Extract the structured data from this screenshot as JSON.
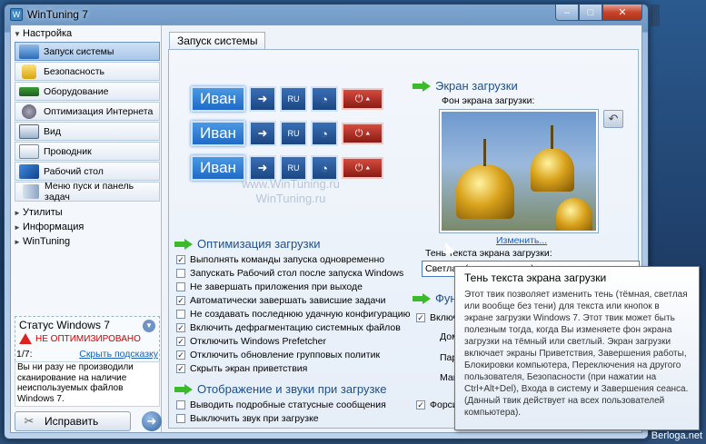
{
  "window": {
    "title": "WinTuning 7",
    "minimize": "–",
    "maximize": "□",
    "close": "✕"
  },
  "sidebar": {
    "header": "Настройка",
    "items": [
      {
        "label": "Запуск системы",
        "icon": "startup-icon"
      },
      {
        "label": "Безопасность",
        "icon": "lock-icon"
      },
      {
        "label": "Оборудование",
        "icon": "hardware-icon"
      },
      {
        "label": "Оптимизация Интернета",
        "icon": "internet-icon"
      },
      {
        "label": "Вид",
        "icon": "view-icon"
      },
      {
        "label": "Проводник",
        "icon": "explorer-icon"
      },
      {
        "label": "Рабочий стол",
        "icon": "desktop-icon"
      },
      {
        "label": "Меню пуск и панель задач",
        "icon": "taskbar-icon"
      }
    ],
    "sections": [
      "Утилиты",
      "Информация",
      "WinTuning"
    ]
  },
  "status": {
    "title": "Статус Windows 7",
    "state": "НЕ ОПТИМИЗИРОВАНО",
    "counter": "1/7:",
    "next_tip": "Скрыть подсказку",
    "tip": "Вы ни разу не производили сканирование на наличие неиспользуемых файлов Windows 7.",
    "fix_label": "Исправить"
  },
  "main": {
    "tab": "Запуск системы",
    "preview": {
      "name": "Иван",
      "ru": "RU",
      "watermark1": "www.WinTuning.ru",
      "watermark2": "WinTuning.ru"
    },
    "boot_opt": {
      "title": "Оптимизация загрузки",
      "options": [
        {
          "label": "Выполнять команды запуска одновременно",
          "checked": true
        },
        {
          "label": "Запускать Рабочий стол после запуска Windows",
          "checked": false
        },
        {
          "label": "Не завершать приложения при выходе",
          "checked": false
        },
        {
          "label": "Автоматически завершать зависшие задачи",
          "checked": true
        },
        {
          "label": "Не создавать последнюю удачную конфигурацию",
          "checked": false
        },
        {
          "label": "Включить дефрагментацию системных файлов",
          "checked": true
        },
        {
          "label": "Отключить Windows Prefetcher",
          "checked": true
        },
        {
          "label": "Отключить обновление групповых политик",
          "checked": true
        },
        {
          "label": "Скрыть экран приветствия",
          "checked": true
        }
      ]
    },
    "display": {
      "title": "Отображение и звуки при загрузке",
      "options": [
        {
          "label": "Выводить подробные статусные сообщения",
          "checked": false
        },
        {
          "label": "Выключить звук при загрузке",
          "checked": false
        }
      ]
    },
    "boot_screen": {
      "title": "Экран загрузки",
      "bg_label": "Фон экрана загрузки:",
      "change_link": "Изменить...",
      "shadow_label": "Тень текста экрана загрузки:",
      "shadow_value": "Светлая (по умолчанию) тень текста экрана загру"
    },
    "functions": {
      "title": "Функ",
      "enable": "Включит",
      "domain": "Доме",
      "password": "Парол",
      "max": "Макси",
      "force": "Форсиро"
    }
  },
  "tooltip": {
    "title": "Тень текста экрана загрузки",
    "body": "Этот твик позволяет изменить тень (тёмная, светлая или вообще без тени) для текста или кнопок в экране загрузки Windows 7. Этот твик может быть полезным тогда, когда Вы изменяете фон экрана загрузки на тёмный или светлый. Экран загрузки включает экраны Приветствия, Завершения работы, Блокировки компьютера, Переключения на другого пользователя, Безопасности (при нажатии на Ctrl+Alt+Del), Входа в систему и Завершения сеанса. (Данный твик действует на всех пользователей компьютера)."
  },
  "watermark": "Berloga.net"
}
